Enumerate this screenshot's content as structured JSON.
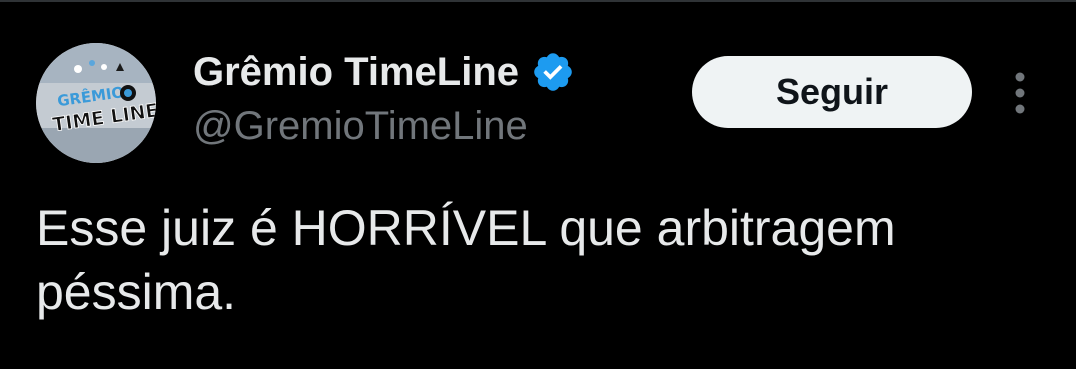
{
  "colors": {
    "background": "#000000",
    "primary_text": "#e7e9ea",
    "secondary_text": "#71767b",
    "verified_blue": "#1d9bf0",
    "follow_button_bg": "#eff3f4",
    "follow_button_text": "#0f1419"
  },
  "author": {
    "avatar_icon": "team-logo-icon",
    "avatar_logo_line1": "GRÊMIO",
    "avatar_logo_line2": "TIME LINE",
    "display_name": "Grêmio TimeLine",
    "verified_icon": "verified-badge-icon",
    "handle": "@GremioTimeLine"
  },
  "actions": {
    "follow_label": "Seguir",
    "more_icon": "more-vertical-icon"
  },
  "tweet": {
    "text": "Esse juiz é HORRÍVEL que arbitragem péssima."
  }
}
